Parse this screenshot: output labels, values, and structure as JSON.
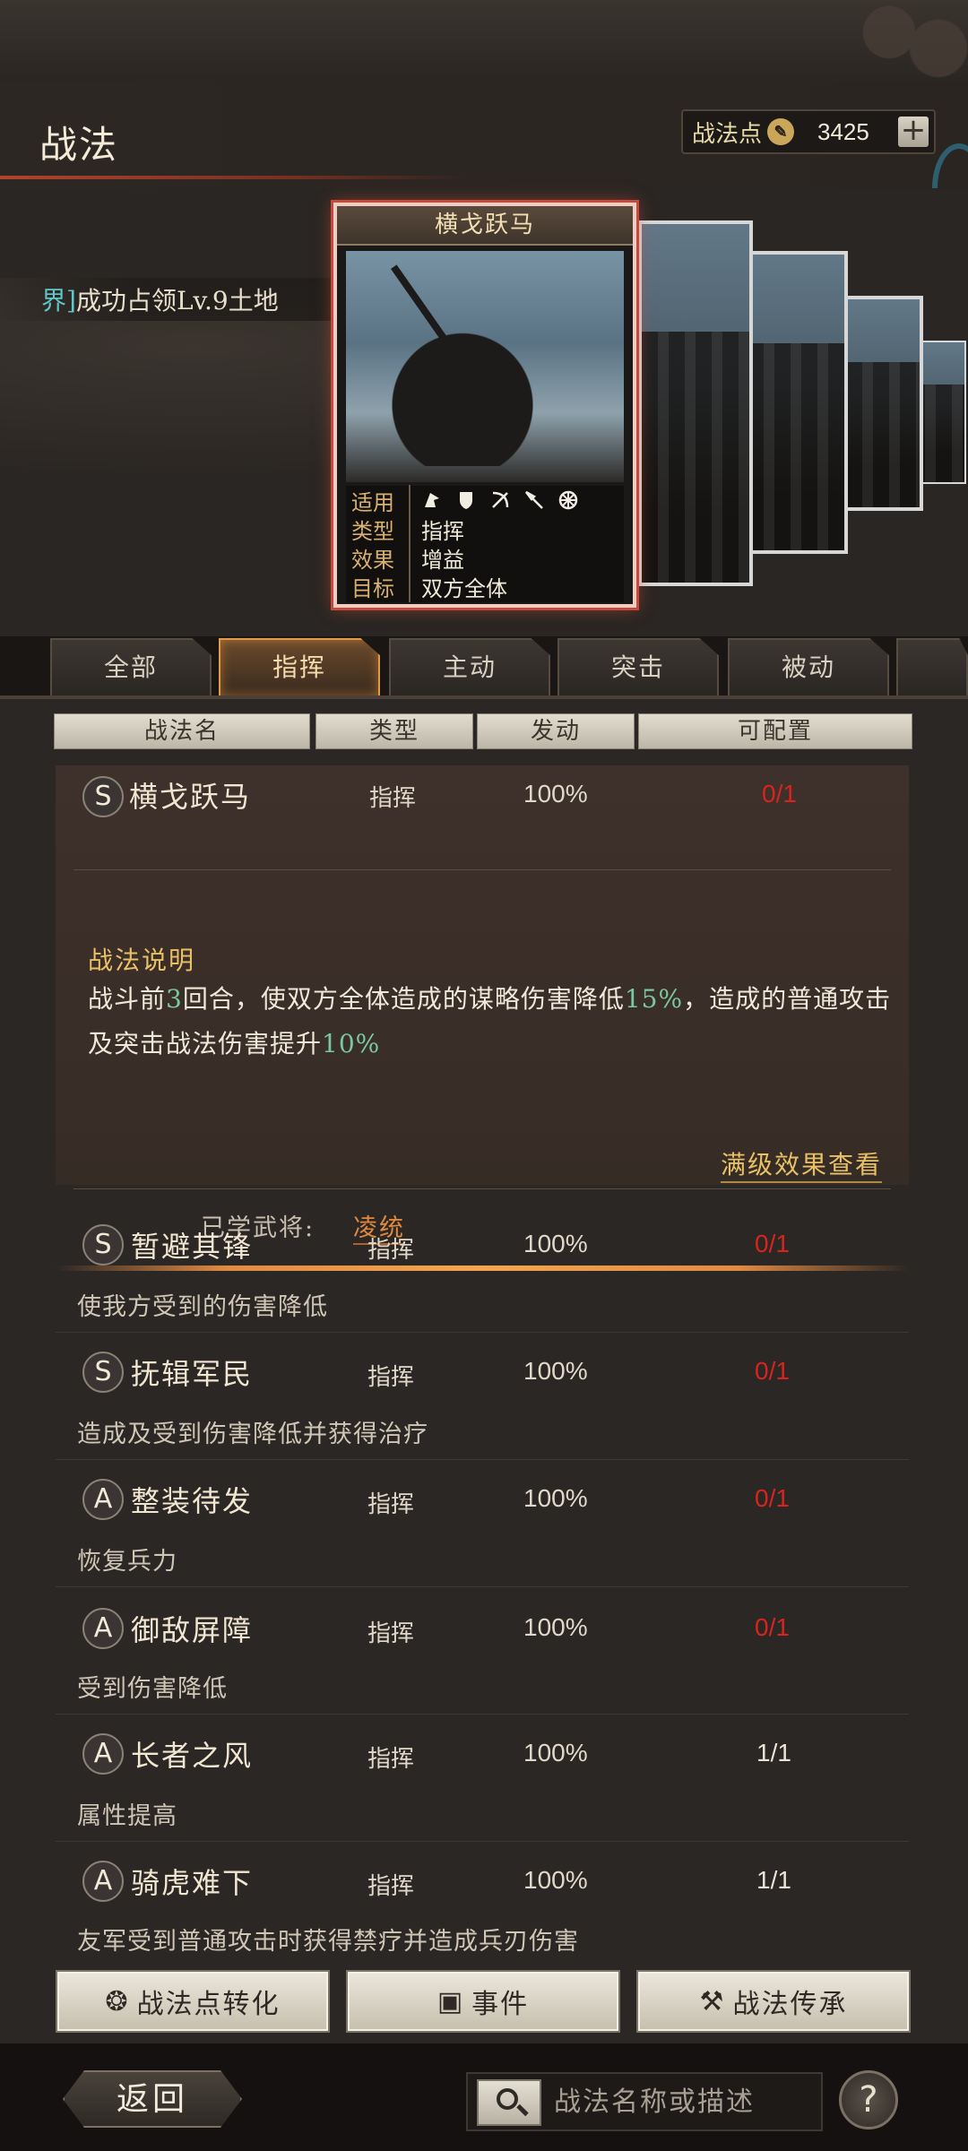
{
  "header": {
    "title": "战法",
    "points_label": "战法点",
    "points_value": "3425",
    "points_add": "+"
  },
  "ticker": {
    "prefix": "界]",
    "text": "成功占领Lv.9土地"
  },
  "card": {
    "title": "横戈跃马",
    "rows": [
      {
        "key": "适用",
        "value": ""
      },
      {
        "key": "类型",
        "value": "指挥"
      },
      {
        "key": "效果",
        "value": "增益"
      },
      {
        "key": "目标",
        "value": "双方全体"
      }
    ],
    "unit_icons": [
      "cavalry-icon",
      "shield-icon",
      "bow-icon",
      "spear-icon",
      "wheel-icon"
    ]
  },
  "tabs": [
    "全部",
    "指挥",
    "主动",
    "突击",
    "被动"
  ],
  "active_tab": "指挥",
  "columns": [
    "战法名",
    "类型",
    "发动",
    "可配置"
  ],
  "expanded": {
    "grade": "S",
    "name": "横戈跃马",
    "type": "指挥",
    "rate": "100%",
    "config": "0/1",
    "desc_title": "战法说明",
    "desc_parts": [
      "战斗前",
      "3",
      "回合，使双方全体造成的谋略伤害降低",
      "15%",
      "，造成的普通攻击及突击战法伤害提升",
      "10%"
    ],
    "full_link": "满级效果查看",
    "learned_label": "已学武将:",
    "learned_name": "凌统"
  },
  "skills": [
    {
      "grade": "S",
      "name": "暂避其锋",
      "type": "指挥",
      "rate": "100%",
      "config": "0/1",
      "config_color": "red",
      "desc": "使我方受到的伤害降低"
    },
    {
      "grade": "S",
      "name": "抚辑军民",
      "type": "指挥",
      "rate": "100%",
      "config": "0/1",
      "config_color": "red",
      "desc": "造成及受到伤害降低并获得治疗"
    },
    {
      "grade": "A",
      "name": "整装待发",
      "type": "指挥",
      "rate": "100%",
      "config": "0/1",
      "config_color": "red",
      "desc": "恢复兵力"
    },
    {
      "grade": "A",
      "name": "御敌屏障",
      "type": "指挥",
      "rate": "100%",
      "config": "0/1",
      "config_color": "red",
      "desc": "受到伤害降低"
    },
    {
      "grade": "A",
      "name": "长者之风",
      "type": "指挥",
      "rate": "100%",
      "config": "1/1",
      "config_color": "white",
      "desc": "属性提高"
    },
    {
      "grade": "A",
      "name": "骑虎难下",
      "type": "指挥",
      "rate": "100%",
      "config": "1/1",
      "config_color": "white",
      "desc": "友军受到普通攻击时获得禁疗并造成兵刃伤害"
    }
  ],
  "buttons": {
    "convert": "战法点转化",
    "event": "事件",
    "inherit": "战法传承"
  },
  "footer": {
    "back": "返回",
    "search_placeholder": "战法名称或描述",
    "help": "?"
  }
}
